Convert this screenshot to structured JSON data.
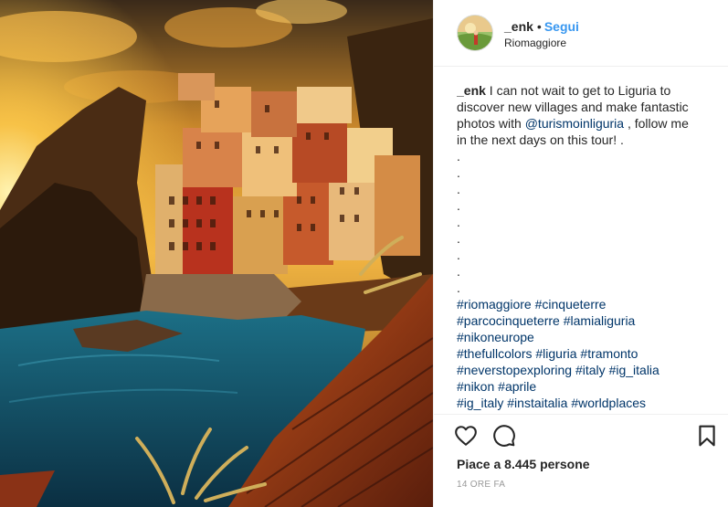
{
  "post": {
    "author": "_enk",
    "separator": "•",
    "follow_label": "Segui",
    "location": "Riomaggiore"
  },
  "caption": {
    "username": "_enk",
    "line1": " I can not wait to get to Liguria to",
    "line2": "discover new villages and make fantastic",
    "line3a": "photos with ",
    "mention": "@turismoinliguria",
    "line3b": " , follow me",
    "line4": "in the next days on this tour! .",
    "dots": [
      ".",
      ".",
      ".",
      ".",
      ".",
      ".",
      ".",
      ".",
      "."
    ],
    "hashtag_lines": [
      [
        "#riomaggiore",
        "#cinqueterre"
      ],
      [
        "#parcocinqueterre",
        "#lamialiguria"
      ],
      [
        "#nikoneurope"
      ],
      [
        "#thefullcolors",
        "#liguria",
        "#tramonto"
      ],
      [
        "#neverstopexploring",
        "#italy",
        "#ig_italia"
      ],
      [
        "#nikon",
        "#aprile"
      ],
      [
        "#ig_italy",
        "#instaitalia",
        "#worldplaces"
      ]
    ]
  },
  "footer": {
    "likes_text": "Piace a 8.445 persone",
    "timestamp": "14 ORE FA"
  },
  "icons": {
    "like": "heart-icon",
    "comment": "comment-icon",
    "save": "bookmark-icon"
  },
  "colors": {
    "follow": "#3897f0",
    "link": "#003569",
    "text": "#262626",
    "muted": "#999999"
  }
}
